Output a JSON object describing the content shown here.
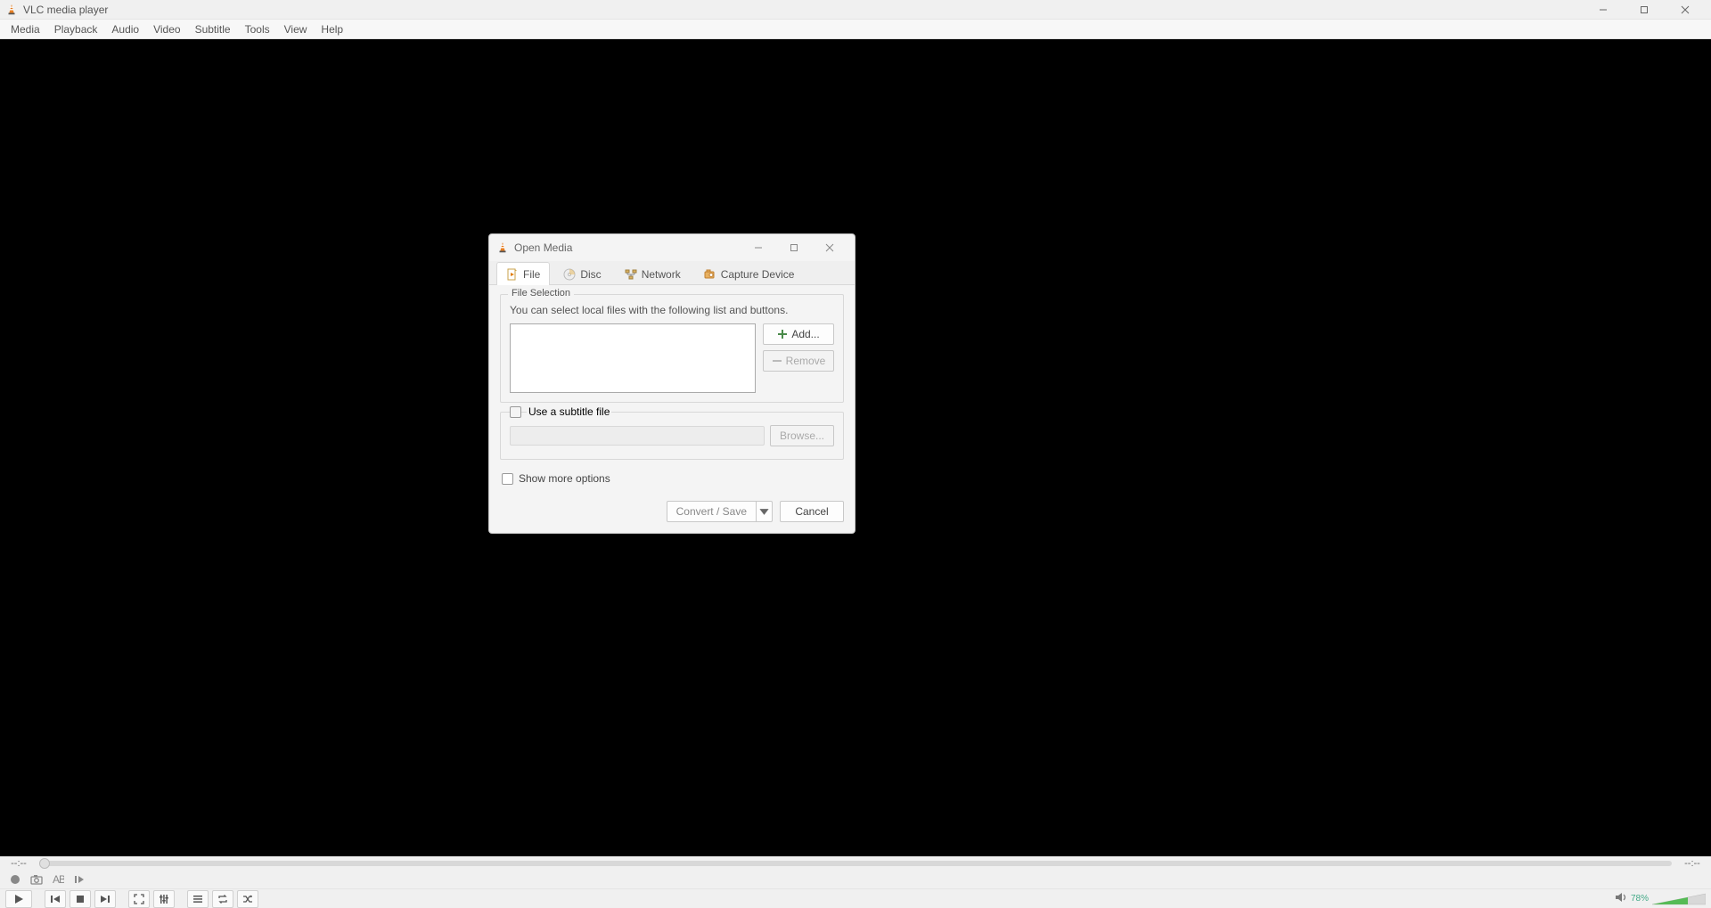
{
  "window": {
    "title": "VLC media player"
  },
  "menubar": [
    "Media",
    "Playback",
    "Audio",
    "Video",
    "Subtitle",
    "Tools",
    "View",
    "Help"
  ],
  "seek": {
    "elapsed": "--:--",
    "remaining": "--:--"
  },
  "volume": {
    "percent_label": "78%"
  },
  "dialog": {
    "title": "Open Media",
    "tabs": {
      "file": "File",
      "disc": "Disc",
      "network": "Network",
      "capture": "Capture Device"
    },
    "file_selection": {
      "legend": "File Selection",
      "hint": "You can select local files with the following list and buttons.",
      "add_label": "Add...",
      "remove_label": "Remove"
    },
    "subtitle": {
      "checkbox_label": "Use a subtitle file",
      "browse_label": "Browse..."
    },
    "show_more": "Show more options",
    "footer": {
      "convert_save": "Convert / Save",
      "cancel": "Cancel"
    }
  }
}
